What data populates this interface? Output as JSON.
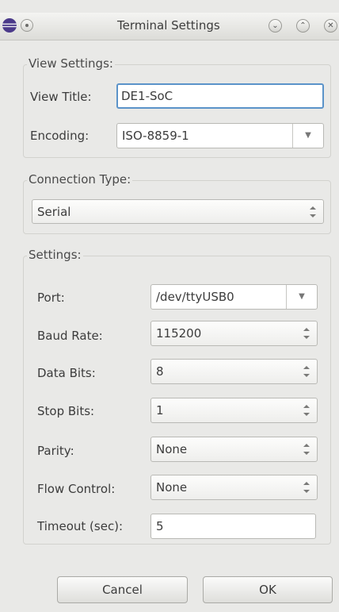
{
  "window": {
    "title": "Terminal Settings",
    "app_icon": "eclipse-icon",
    "controls": [
      "minimize-icon",
      "maximize-icon",
      "close-icon"
    ]
  },
  "view_settings": {
    "group_title": "View Settings:",
    "view_title_label": "View Title:",
    "view_title_value": "DE1-SoC",
    "encoding_label": "Encoding:",
    "encoding_value": "ISO-8859-1"
  },
  "connection_type": {
    "group_title": "Connection Type:",
    "value": "Serial"
  },
  "settings": {
    "group_title": "Settings:",
    "port_label": "Port:",
    "port_value": "/dev/ttyUSB0",
    "baud_rate_label": "Baud Rate:",
    "baud_rate_value": "115200",
    "data_bits_label": "Data Bits:",
    "data_bits_value": "8",
    "stop_bits_label": "Stop Bits:",
    "stop_bits_value": "1",
    "parity_label": "Parity:",
    "parity_value": "None",
    "flow_control_label": "Flow Control:",
    "flow_control_value": "None",
    "timeout_label": "Timeout (sec):",
    "timeout_value": "5"
  },
  "buttons": {
    "cancel": "Cancel",
    "ok": "OK"
  },
  "colors": {
    "background": "#e9e9e7",
    "focus_border": "#5b93c9",
    "app_icon": "#4b3a8a"
  }
}
